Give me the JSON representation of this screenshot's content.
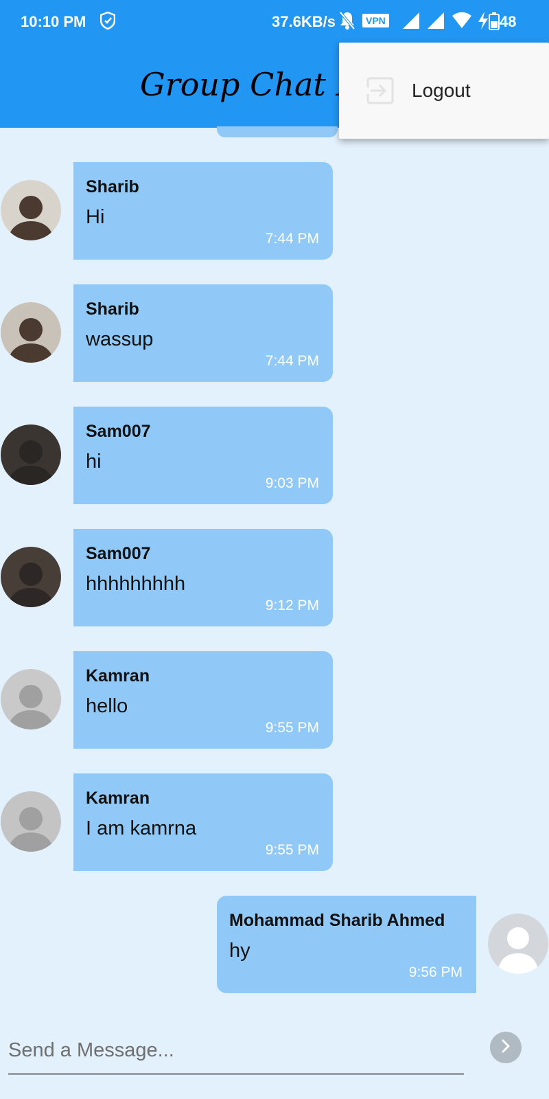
{
  "status_bar": {
    "time": "10:10 PM",
    "net_speed": "37.6KB/s",
    "vpn": "VPN",
    "battery": "48",
    "icons": [
      "shield-icon",
      "bell-off-icon",
      "signal-icon",
      "signal-icon",
      "wifi-icon",
      "charging-icon",
      "battery-icon"
    ]
  },
  "app_bar": {
    "title": "Group Chat In"
  },
  "overflow_menu": {
    "items": [
      {
        "label": "Logout",
        "icon": "logout-icon"
      }
    ]
  },
  "messages": [
    {
      "sender": "Sharib",
      "text": "Hi",
      "time": "7:44 PM",
      "side": "left",
      "avatar": "photo"
    },
    {
      "sender": "Sharib",
      "text": "wassup",
      "time": "7:44 PM",
      "side": "left",
      "avatar": "photo"
    },
    {
      "sender": "Sam007",
      "text": "hi",
      "time": "9:03 PM",
      "side": "left",
      "avatar": "photo"
    },
    {
      "sender": "Sam007",
      "text": "hhhhhhhhh",
      "time": "9:12 PM",
      "side": "left",
      "avatar": "photo"
    },
    {
      "sender": "Kamran",
      "text": "hello",
      "time": "9:55 PM",
      "side": "left",
      "avatar": "photo"
    },
    {
      "sender": "Kamran",
      "text": "I am kamrna",
      "time": "9:55 PM",
      "side": "left",
      "avatar": "photo"
    },
    {
      "sender": "Mohammad Sharib Ahmed",
      "text": "hy",
      "time": "9:56 PM",
      "side": "right",
      "avatar": "default-user"
    }
  ],
  "composer": {
    "placeholder": "Send a Message...",
    "value": ""
  },
  "colors": {
    "primary": "#2196f3",
    "background": "#e3f1fc",
    "bubble": "#90c9f7",
    "menu_bg": "#f8f8f8"
  }
}
